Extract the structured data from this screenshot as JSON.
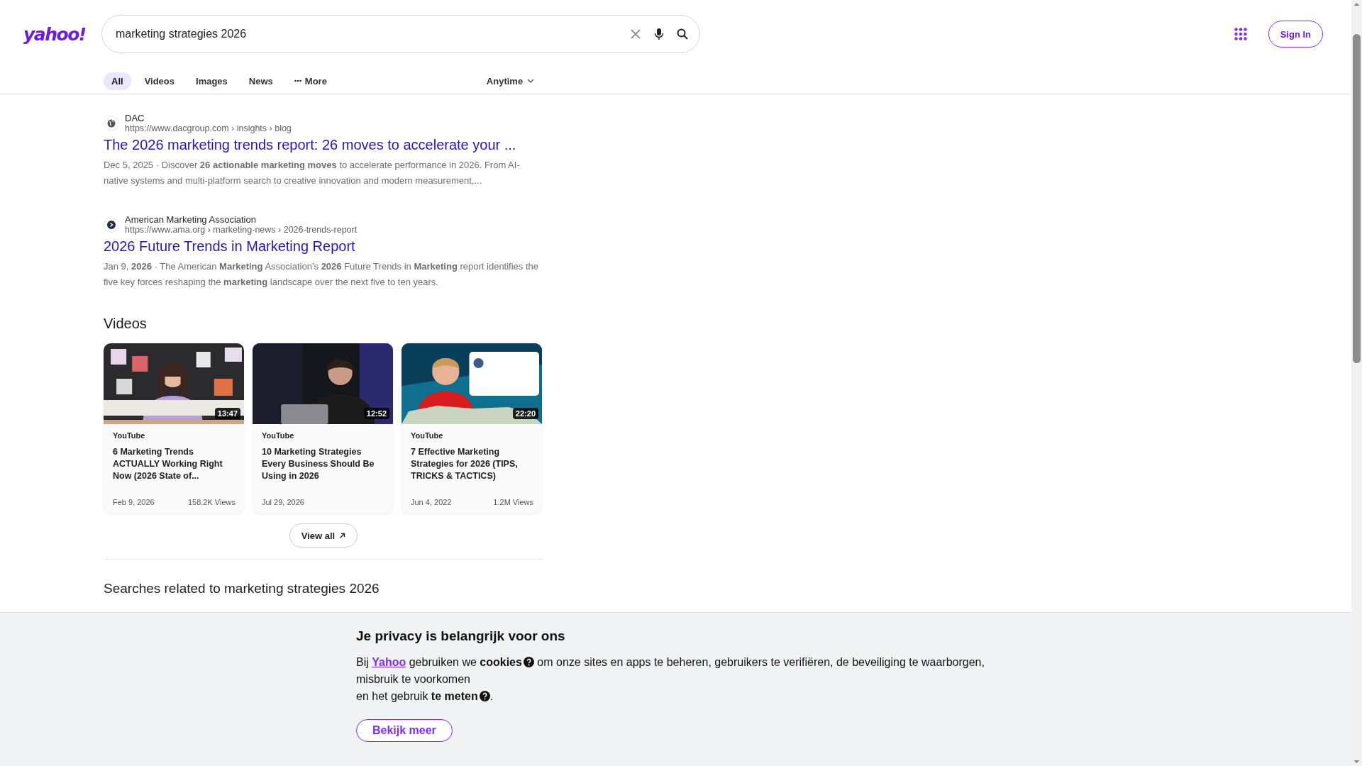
{
  "logo": "yahoo!",
  "search": {
    "value": "marketing strategies 2026"
  },
  "sign_in": "Sign In",
  "tabs": [
    {
      "label": "All",
      "selected": true,
      "kind": "plain"
    },
    {
      "label": "Videos",
      "selected": false,
      "kind": "plain"
    },
    {
      "label": "Images",
      "selected": false,
      "kind": "plain"
    },
    {
      "label": "News",
      "selected": false,
      "kind": "plain"
    },
    {
      "label": "More",
      "selected": false,
      "kind": "more"
    }
  ],
  "time_filter": "Anytime",
  "results": [
    {
      "kind": "globe",
      "source": "DAC",
      "url": "https://www.dacgroup.com › insights › blog",
      "title": "The 2026 marketing trends report: 26 moves to accelerate your ...",
      "snippet": "Dec 5, 2025 · Discover **26 actionable marketing moves** to accelerate performance in 2026. From AI-native systems and multi-platform search to creative innovation and modern measurement,..."
    },
    {
      "kind": "arrow",
      "source": "American Marketing Association",
      "url": "https://www.ama.org › marketing-news › 2026-trends-report",
      "title": "2026 Future Trends in Marketing Report",
      "snippet": "Jan 9, **2026** · The American **Marketing** Association’s **2026** Future Trends in **Marketing** report identifies the five key forces reshaping the **marketing** landscape over the next five to ten years."
    }
  ],
  "videos": {
    "heading": "Videos",
    "view_all": "View all",
    "items": [
      {
        "duration": "13:47",
        "source": "YouTube",
        "title": "6 Marketing Trends ACTUALLY Working Right Now (2026 State of...",
        "date": "Feb 9, 2026",
        "views": "158.2K Views"
      },
      {
        "duration": "12:52",
        "source": "YouTube",
        "title": "10 Marketing Strategies Every Business Should Be Using in 2026",
        "date": "Jul 29, 2026"
      },
      {
        "duration": "22:20",
        "source": "YouTube",
        "title": "7 Effective Marketing Strategies for 2026 (TIPS, TRICKS & TACTICS)",
        "date": "Jun 4, 2022",
        "views": "1.2M Views"
      }
    ]
  },
  "related": {
    "heading": "Searches related to marketing strategies 2026"
  },
  "privacy": {
    "title": "Je privacy is belangrijk voor ons",
    "button": "Bekijk meer",
    "body": [
      {
        "kind": "text",
        "text": "Bij "
      },
      {
        "kind": "link",
        "text": "Yahoo"
      },
      {
        "kind": "text",
        "text": " gebruiken we **cookies**"
      },
      {
        "kind": "help"
      },
      {
        "kind": "text",
        "text": " om onze sites en apps te beheren, gebruikers te verifiëren, de beveiliging te waarborgen, misbruik te voorkomen"
      },
      {
        "kind": "break"
      },
      {
        "kind": "text",
        "text": "en het gebruik **te meten**"
      },
      {
        "kind": "help"
      },
      {
        "kind": "text",
        "text": "."
      }
    ]
  }
}
